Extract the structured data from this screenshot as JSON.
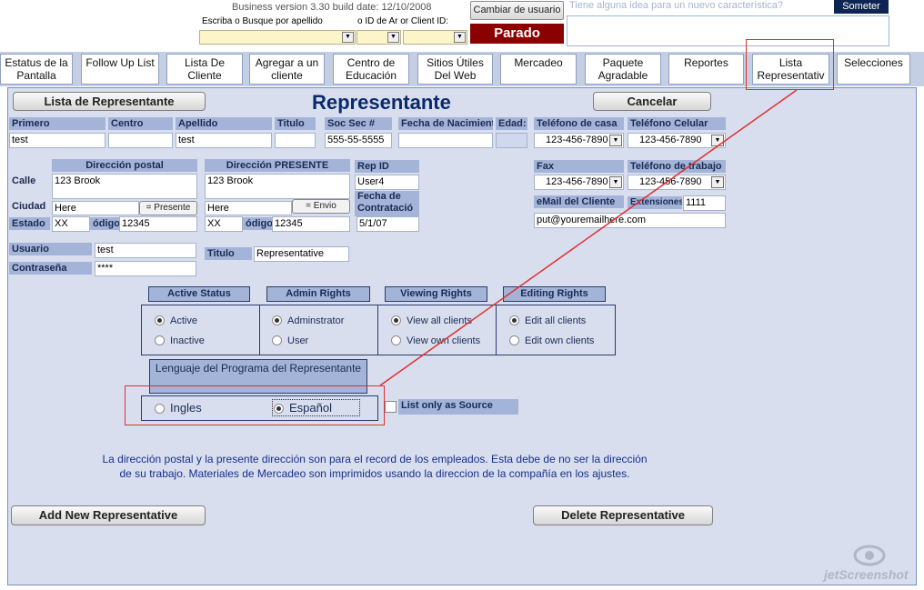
{
  "header": {
    "build_info": "Business version 3.30  build date: 12/10/2008",
    "search_label": "Escriba o Busque por apellido",
    "id_label": "o ID de Ar or Client ID:",
    "change_user": "Cambiar de usuario",
    "status": "Parado",
    "idea_placeholder": "Tiene alguna idea para un nuevo característica?",
    "submit": "Someter"
  },
  "nav": [
    {
      "line1": "Estatus de la",
      "line2": "Pantalla"
    },
    {
      "line1": "Follow Up List",
      "line2": ""
    },
    {
      "line1": "Lista  De",
      "line2": "Cliente"
    },
    {
      "line1": "Agregar a un",
      "line2": "cliente"
    },
    {
      "line1": "Centro de",
      "line2": "Educación"
    },
    {
      "line1": "Sitios Útiles",
      "line2": "Del Web"
    },
    {
      "line1": "Mercadeo",
      "line2": ""
    },
    {
      "line1": "Paquete",
      "line2": "Agradable"
    },
    {
      "line1": "Reportes",
      "line2": ""
    },
    {
      "line1": "Lista",
      "line2": "Representativ"
    },
    {
      "line1": "Selecciones",
      "line2": ""
    }
  ],
  "form": {
    "list_button": "Lista de Representante",
    "title": "Representante",
    "cancel_button": "Cancelar",
    "labels": {
      "first": "Primero",
      "middle": "Centro",
      "last": "Apellido",
      "title": "Titulo",
      "ssn": "Soc Sec #",
      "birth": "Fecha de Nacimiento",
      "age": "Edad:",
      "home_phone": "Teléfono de casa",
      "cell_phone": "Teléfono  Celular",
      "mail_address": "Dirección postal",
      "present_address": "Dirección PRESENTE",
      "street": "Calle",
      "city": "Ciudad",
      "state": "Estado",
      "zip_mail": "ódigo",
      "zip_present": "ódigo",
      "rep_id": "Rep ID",
      "hire_date_1": "Fecha de",
      "hire_date_2": "Contratació",
      "fax": "Fax",
      "work_phone": "Teléfono de trabajo",
      "email": "eMail del Cliente",
      "extensions": "Extensiones",
      "user": "Usuario",
      "password": "Contraseña",
      "job_title": "Titulo"
    },
    "values": {
      "first": "test",
      "middle": "",
      "last": "test",
      "title": "",
      "ssn": "555-55-5555",
      "birth": "",
      "age": "",
      "home_phone": "123-456-7890",
      "cell_phone": "123-456-7890",
      "mail_street": "123 Brook",
      "present_street": "123 Brook",
      "mail_city": "Here",
      "present_city": "Here",
      "mail_state": "XX",
      "mail_zip": "12345",
      "present_state": "XX",
      "present_zip": "12345",
      "rep_id": "User4",
      "hire_date": "5/1/07",
      "fax": "123-456-7890",
      "work_phone": "123-456-7890",
      "email": "put@youremailhere.com",
      "extensions": "1111",
      "user": "test",
      "password": "****",
      "job_title": "Representative"
    },
    "present_button": "= Presente",
    "envio_button": "= Envio"
  },
  "rights": {
    "active_status": {
      "label": "Active Status",
      "options": [
        "Active",
        "Inactive"
      ],
      "selected": 0
    },
    "admin_rights": {
      "label": "Admin Rights",
      "options": [
        "Adminstrator",
        "User"
      ],
      "selected": 0
    },
    "viewing_rights": {
      "label": "Viewing Rights",
      "options": [
        "View all clients",
        "View own clients"
      ],
      "selected": 0
    },
    "editing_rights": {
      "label": "Editing Rights",
      "options": [
        "Edit all clients",
        "Edit own clients"
      ],
      "selected": 0
    }
  },
  "language": {
    "label": "Lenguaje del Programa del Representante",
    "options": [
      "Ingles",
      "Español"
    ],
    "selected": 1,
    "source_only": "List only as Source"
  },
  "notice": {
    "line1": "La dirección postal y la presente dirección son para el record de los empleados. Esta debe de no ser la dirección",
    "line2": "de su trabajo. Materiales de Mercadeo son imprimidos usando la direccion  de la compañía  en los ajustes."
  },
  "actions": {
    "add": "Add New Representative",
    "delete": "Delete Representative"
  },
  "watermark": "jetScreenshot"
}
